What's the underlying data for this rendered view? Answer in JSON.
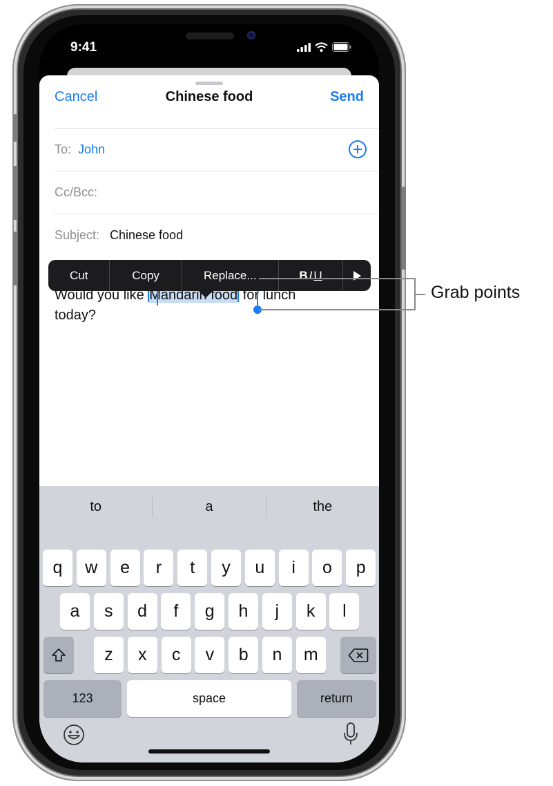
{
  "status_bar": {
    "time": "9:41"
  },
  "nav": {
    "cancel": "Cancel",
    "title": "Chinese food",
    "send": "Send"
  },
  "fields": {
    "to_label": "To:",
    "to_value": "John",
    "cc_label": "Cc/Bcc:",
    "subject_label": "Subject:",
    "subject_value": "Chinese food"
  },
  "body": {
    "before": "Would you like ",
    "selected": "Mandarin food",
    "after": " for lunch",
    "line2": "today?"
  },
  "edit_menu": {
    "cut": "Cut",
    "copy": "Copy",
    "replace": "Replace...",
    "bold": "B",
    "italic": "I",
    "underline": "U"
  },
  "keyboard": {
    "predictions": [
      "to",
      "a",
      "the"
    ],
    "row1": [
      "q",
      "w",
      "e",
      "r",
      "t",
      "y",
      "u",
      "i",
      "o",
      "p"
    ],
    "row2": [
      "a",
      "s",
      "d",
      "f",
      "g",
      "h",
      "j",
      "k",
      "l"
    ],
    "row3": [
      "z",
      "x",
      "c",
      "v",
      "b",
      "n",
      "m"
    ],
    "numbers_key": "123",
    "space_key": "space",
    "return_key": "return"
  },
  "callout": {
    "label": "Grab points"
  },
  "colors": {
    "accent": "#1a7cf3",
    "selection": "#c8dcf3",
    "keyboard_bg": "#d1d4da"
  }
}
